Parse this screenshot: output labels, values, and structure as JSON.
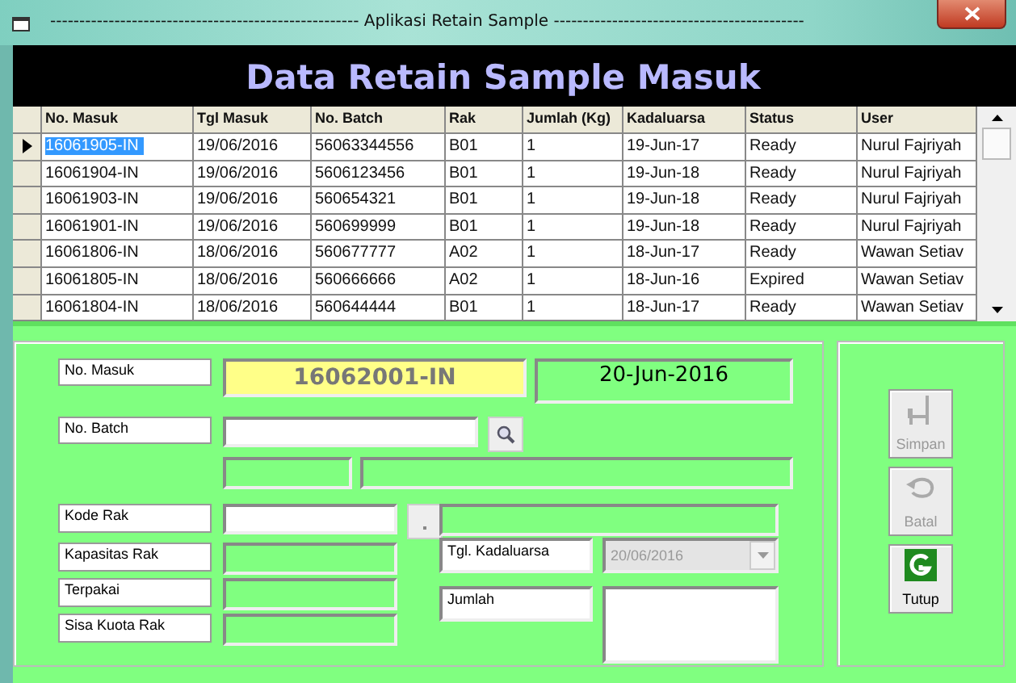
{
  "window": {
    "title": "----------------------------------------------------- Aplikasi Retain Sample -------------------------------------------"
  },
  "heading": "Data Retain Sample Masuk",
  "table": {
    "columns": [
      "No. Masuk",
      "Tgl Masuk",
      "No. Batch",
      "Rak",
      "Jumlah (Kg)",
      "Kadaluarsa",
      "Status",
      "User"
    ],
    "rows": [
      {
        "selected": true,
        "cells": [
          "16061905-IN",
          "19/06/2016",
          "56063344556",
          "B01",
          "1",
          "19-Jun-17",
          "Ready",
          "Nurul Fajriyah"
        ]
      },
      {
        "selected": false,
        "cells": [
          "16061904-IN",
          "19/06/2016",
          "5606123456",
          "B01",
          "1",
          "19-Jun-18",
          "Ready",
          "Nurul Fajriyah"
        ]
      },
      {
        "selected": false,
        "cells": [
          "16061903-IN",
          "19/06/2016",
          "560654321",
          "B01",
          "1",
          "19-Jun-18",
          "Ready",
          "Nurul Fajriyah"
        ]
      },
      {
        "selected": false,
        "cells": [
          "16061901-IN",
          "19/06/2016",
          "560699999",
          "B01",
          "1",
          "19-Jun-18",
          "Ready",
          "Nurul Fajriyah"
        ]
      },
      {
        "selected": false,
        "cells": [
          "16061806-IN",
          "18/06/2016",
          "560677777",
          "A02",
          "1",
          "18-Jun-17",
          "Ready",
          "Wawan Setiav"
        ]
      },
      {
        "selected": false,
        "cells": [
          "16061805-IN",
          "18/06/2016",
          "560666666",
          "A02",
          "1",
          "18-Jun-16",
          "Expired",
          "Wawan Setiav"
        ]
      },
      {
        "selected": false,
        "cells": [
          "16061804-IN",
          "18/06/2016",
          "560644444",
          "B01",
          "1",
          "18-Jun-17",
          "Ready",
          "Wawan Setiav"
        ]
      }
    ]
  },
  "form": {
    "no_masuk": {
      "label": "No. Masuk",
      "value": "16062001-IN"
    },
    "date": "20-Jun-2016",
    "no_batch": {
      "label": "No. Batch"
    },
    "kode_rak": {
      "label": "Kode Rak"
    },
    "kapasitas_rak": {
      "label": "Kapasitas Rak"
    },
    "terpakai": {
      "label": "Terpakai"
    },
    "sisa_kuota_rak": {
      "label": "Sisa Kuota Rak"
    },
    "tgl_kadaluarsa": {
      "label": "Tgl. Kadaluarsa",
      "value": "20/06/2016",
      "disabled": true
    },
    "jumlah": {
      "label": "Jumlah"
    }
  },
  "buttons": [
    {
      "kind": "save",
      "label": "Simpan",
      "disabled": true
    },
    {
      "kind": "cancel",
      "label": "Batal",
      "disabled": true
    },
    {
      "kind": "close",
      "label": "Tutup",
      "disabled": false
    }
  ]
}
